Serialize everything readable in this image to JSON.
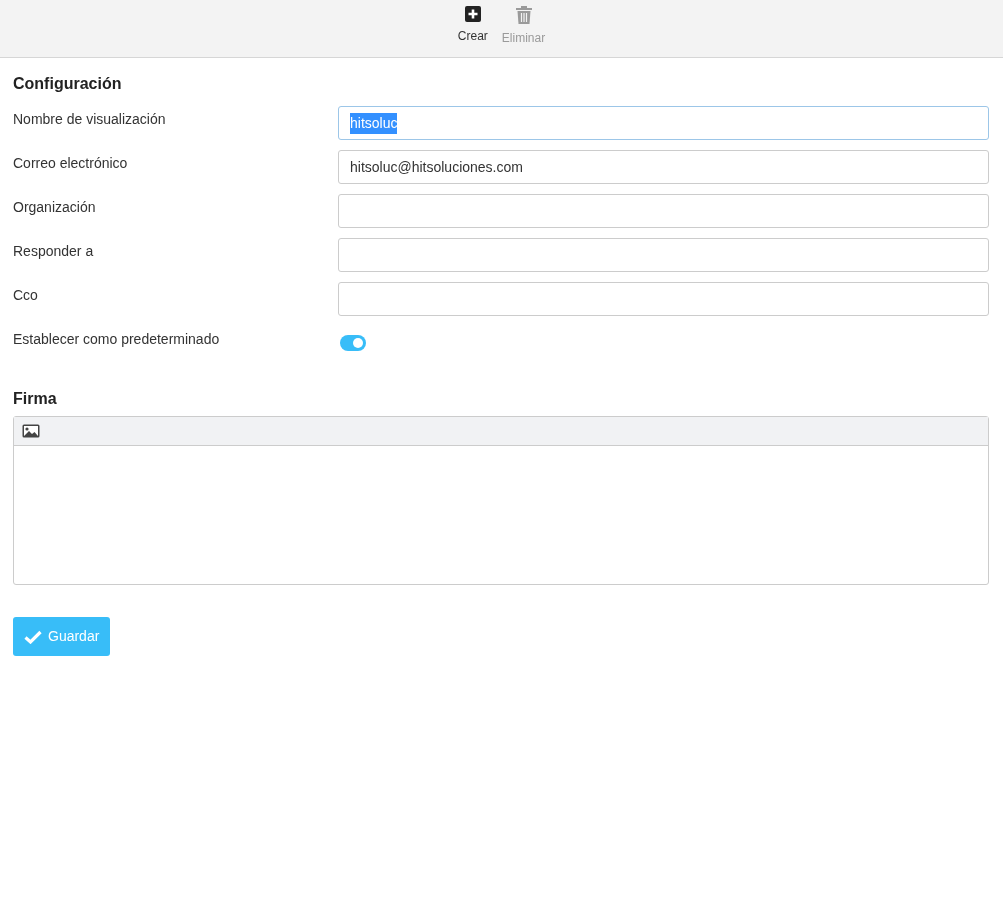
{
  "toolbar": [
    {
      "kind": "create",
      "label": "Crear",
      "disabled": false
    },
    {
      "kind": "delete",
      "label": "Eliminar",
      "disabled": true
    }
  ],
  "settings": {
    "title": "Configuración",
    "fields": [
      {
        "kind": "text",
        "label": "Nombre de visualización",
        "value": "hitsoluc",
        "focused": true,
        "text_selected": true
      },
      {
        "kind": "text",
        "label": "Correo electrónico",
        "value": "hitsoluc@hitsoluciones.com",
        "focused": false,
        "text_selected": false
      },
      {
        "kind": "text",
        "label": "Organización",
        "focused": false
      },
      {
        "kind": "text",
        "label": "Responder a",
        "focused": false
      },
      {
        "kind": "text",
        "label": "Cco",
        "focused": false
      },
      {
        "kind": "toggle",
        "label": "Establecer como predeterminado",
        "on": true
      }
    ]
  },
  "signature": {
    "title": "Firma"
  },
  "save_button": {
    "label": "Guardar"
  }
}
